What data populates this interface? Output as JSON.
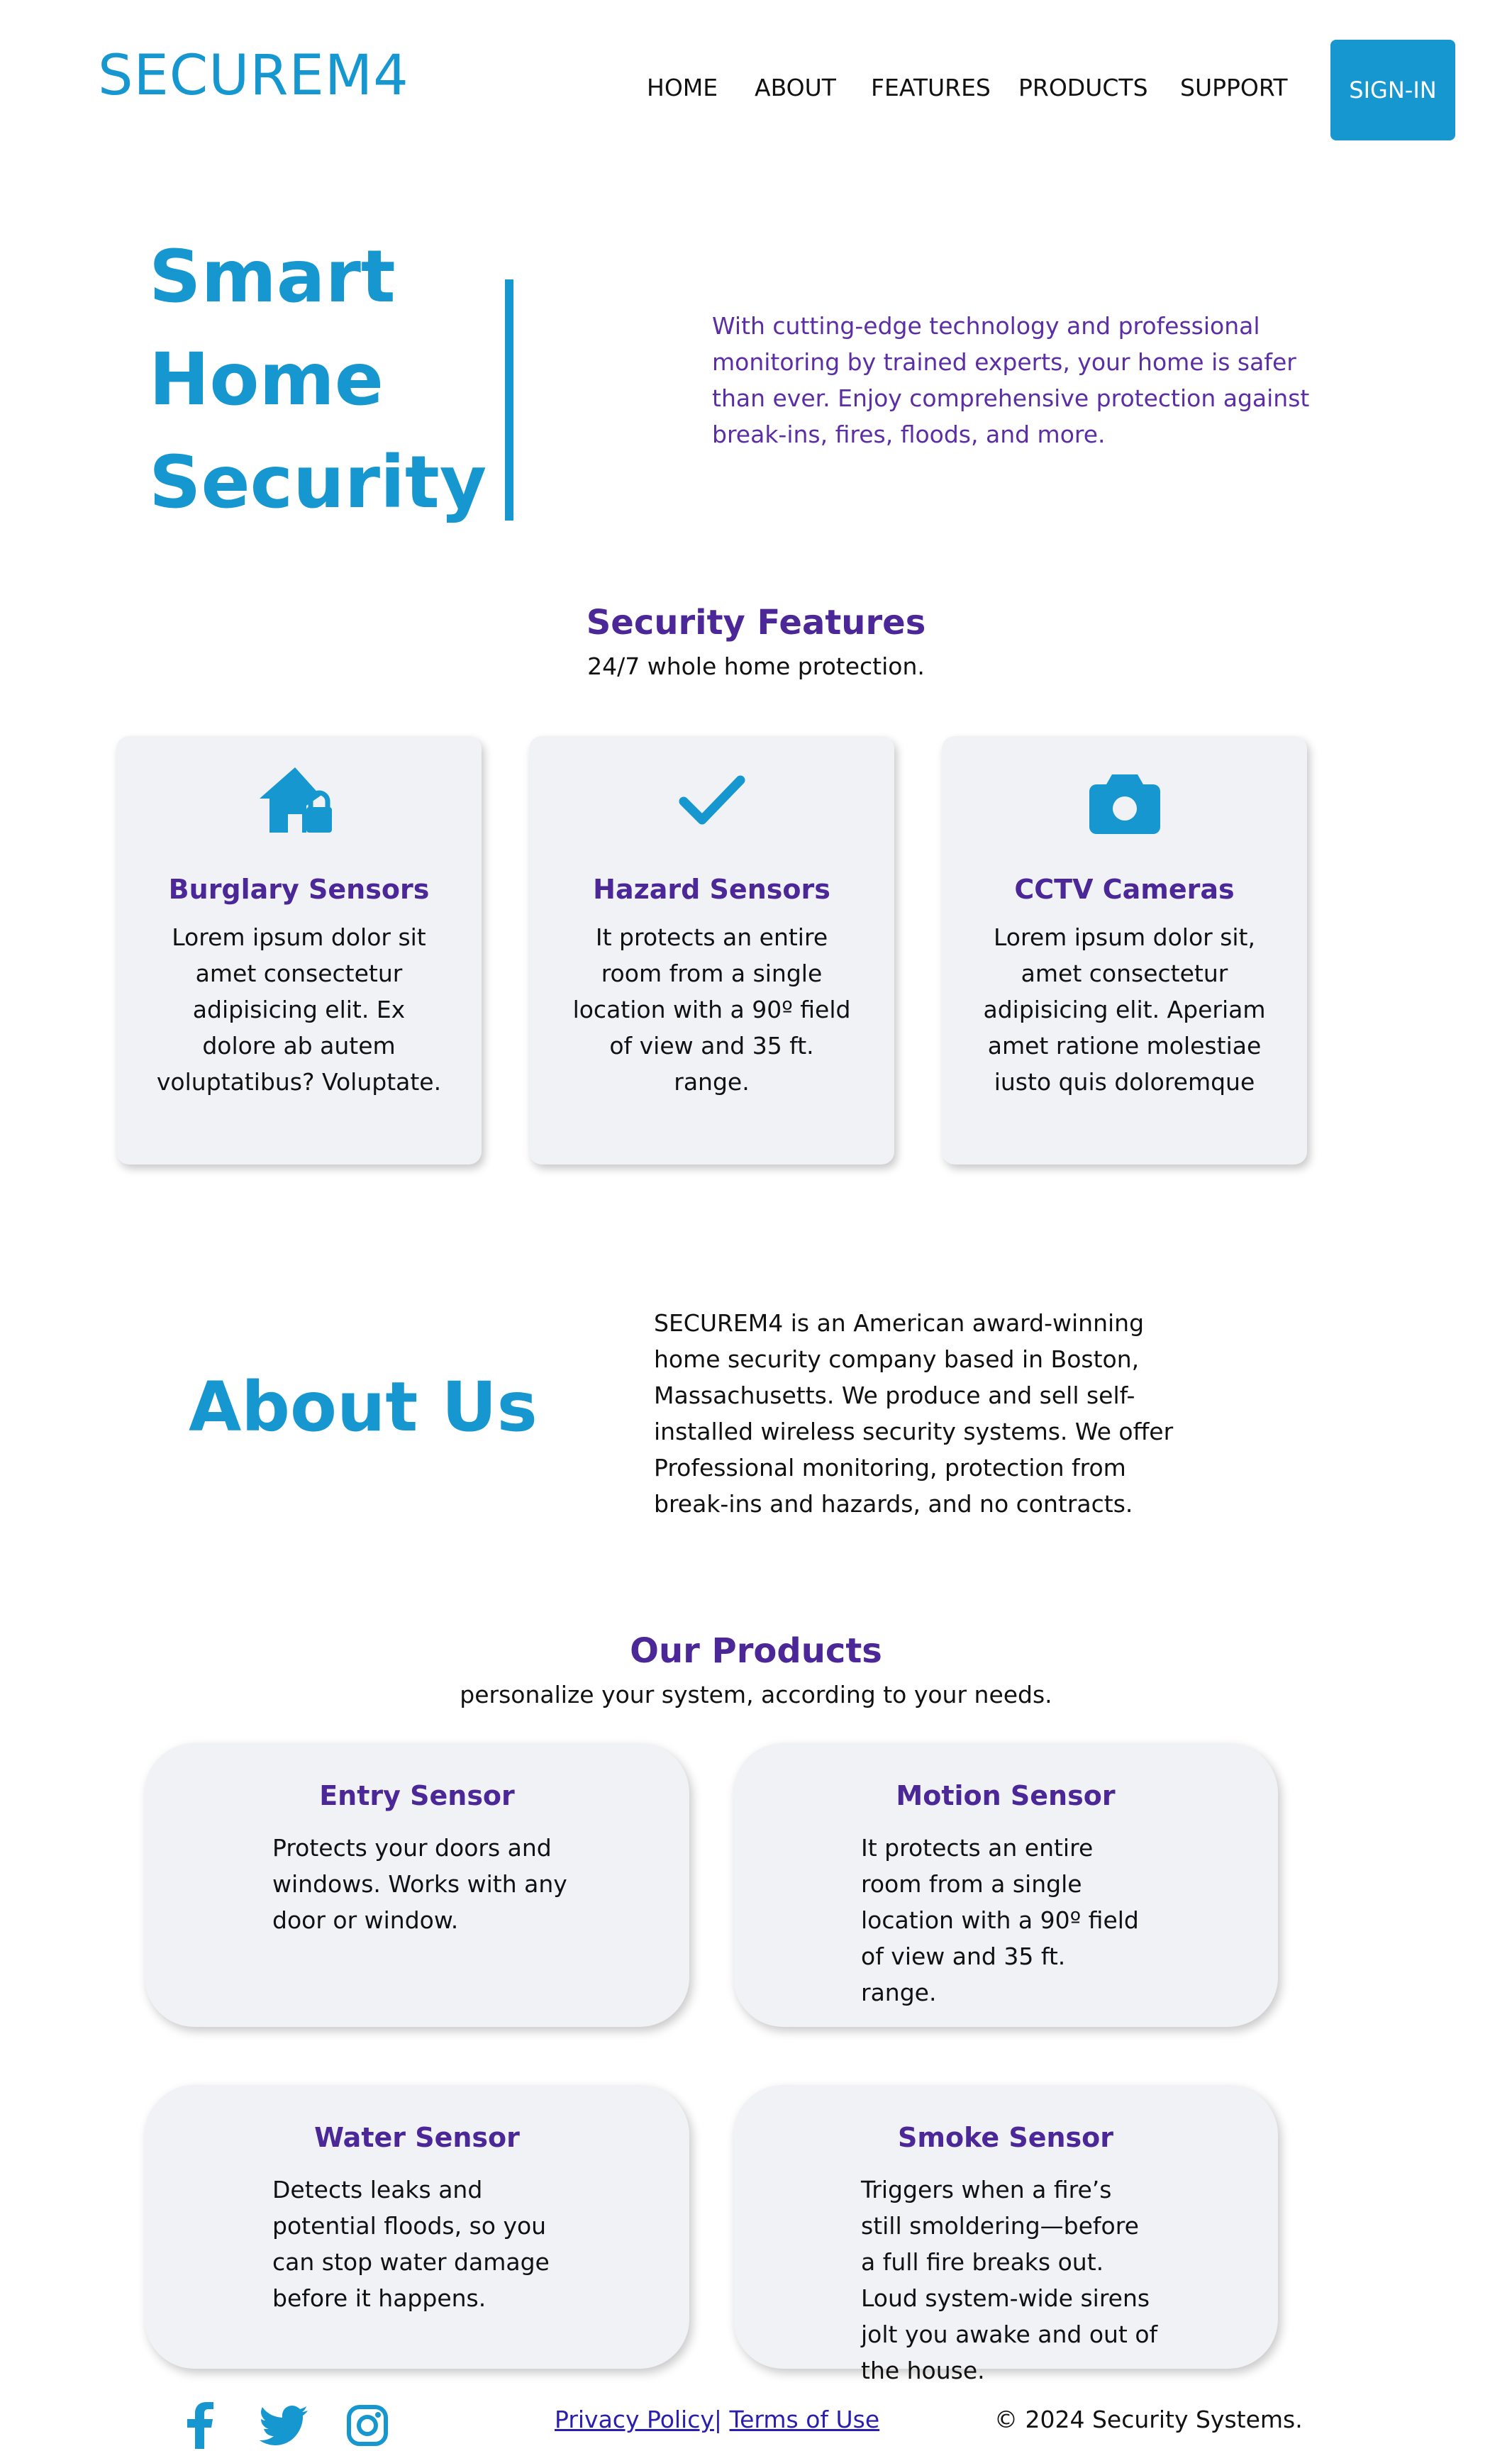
{
  "brand": {
    "logo": "SECUREM4",
    "accent": "#1697d0",
    "heading_color": "#4b2797"
  },
  "nav": {
    "items": [
      "HOME",
      "ABOUT",
      "FEATURES",
      "PRODUCTS",
      "SUPPORT"
    ],
    "signin": "SIGN-IN"
  },
  "hero": {
    "title_lines": [
      "Smart",
      "Home",
      "Security"
    ],
    "text": "With cutting-edge technology and professional monitoring by trained experts, your home is safer than ever. Enjoy comprehensive protection against break-ins, fires, floods, and more."
  },
  "features": {
    "title": "Security Features",
    "subtitle": "24/7 whole home protection.",
    "cards": [
      {
        "icon": "house-lock-icon",
        "title": "Burglary Sensors",
        "text": "Lorem ipsum dolor sit amet consectetur adipisicing elit. Ex dolore ab autem voluptatibus? Voluptate."
      },
      {
        "icon": "check-icon",
        "title": "Hazard Sensors",
        "text": "It protects an entire room from a single location with a 90º field of view and 35 ft. range."
      },
      {
        "icon": "camera-icon",
        "title": "CCTV Cameras",
        "text": "Lorem ipsum dolor sit, amet consectetur adipisicing elit. Aperiam amet ratione molestiae iusto quis doloremque"
      }
    ]
  },
  "about": {
    "title": "About Us",
    "text": "SECUREM4 is an American award-winning home security company based in Boston, Massachusetts. We produce and sell self-installed wireless security systems. We offer Professional monitoring, protection from break-ins and hazards, and no contracts."
  },
  "products": {
    "title": "Our Products",
    "subtitle": "personalize your system, according to your needs.",
    "cards": [
      {
        "title": "Entry Sensor",
        "text": "Protects your doors and windows. Works with any door or window."
      },
      {
        "title": "Motion Sensor",
        "text": "It protects an entire room from a single location with a 90º field of view and 35 ft. range."
      },
      {
        "title": "Water Sensor",
        "text": "Detects leaks and potential floods, so you can stop water damage before it happens."
      },
      {
        "title": "Smoke Sensor",
        "text": "Triggers when a fire’s still smoldering—before a full fire breaks out. Loud system-wide sirens jolt you awake and out of the house."
      }
    ]
  },
  "footer": {
    "social": [
      "facebook-icon",
      "twitter-icon",
      "instagram-icon"
    ],
    "privacy": "Privacy Policy",
    "separator": "|",
    "terms": "Terms of Use",
    "copyright": "© 2024 Security Systems."
  }
}
